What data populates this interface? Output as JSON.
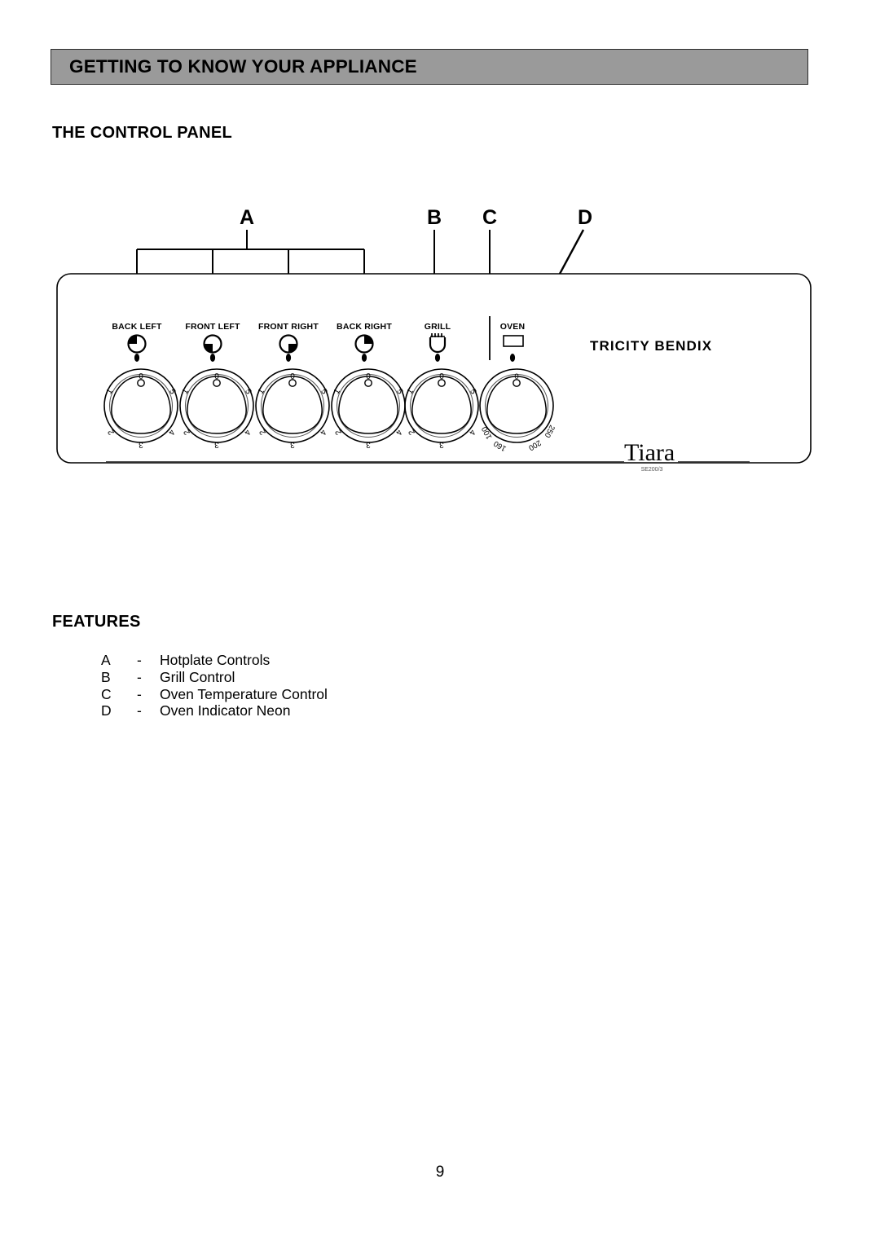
{
  "header": {
    "title": "GETTING TO KNOW YOUR APPLIANCE"
  },
  "sections": {
    "control_panel_heading": "THE CONTROL PANEL",
    "features_heading": "FEATURES"
  },
  "diagram": {
    "callouts": [
      {
        "id": "A",
        "label": "A"
      },
      {
        "id": "B",
        "label": "B"
      },
      {
        "id": "C",
        "label": "C"
      },
      {
        "id": "D",
        "label": "D"
      }
    ],
    "controls": [
      {
        "label": "BACK LEFT",
        "icon": "hotplate-back-left-icon",
        "knob": "hotplate"
      },
      {
        "label": "FRONT LEFT",
        "icon": "hotplate-front-left-icon",
        "knob": "hotplate"
      },
      {
        "label": "FRONT RIGHT",
        "icon": "hotplate-front-right-icon",
        "knob": "hotplate"
      },
      {
        "label": "BACK RIGHT",
        "icon": "hotplate-back-right-icon",
        "knob": "hotplate"
      },
      {
        "label": "GRILL",
        "icon": "grill-icon",
        "knob": "hotplate"
      },
      {
        "label": "OVEN",
        "icon": "oven-neon-icon",
        "knob": "oven"
      }
    ],
    "hotplate_knob_marks": [
      "0",
      "1",
      "2",
      "3",
      "4",
      "5"
    ],
    "oven_knob_marks": [
      "0",
      "100",
      "160",
      "200",
      "250"
    ],
    "brand": "TRICITY BENDIX",
    "model_logo": "Tiara",
    "model_code": "SE200/3"
  },
  "features": [
    {
      "key": "A",
      "dash": "-",
      "label": "Hotplate Controls"
    },
    {
      "key": "B",
      "dash": "-",
      "label": "Grill Control"
    },
    {
      "key": "C",
      "dash": "-",
      "label": "Oven Temperature Control"
    },
    {
      "key": "D",
      "dash": "-",
      "label": "Oven Indicator Neon"
    }
  ],
  "footer": {
    "page_number": "9"
  },
  "colors": {
    "banner_fill": "#9a9a9a",
    "banner_border": "#2b2b2b",
    "ink": "#000000",
    "paper": "#ffffff"
  }
}
